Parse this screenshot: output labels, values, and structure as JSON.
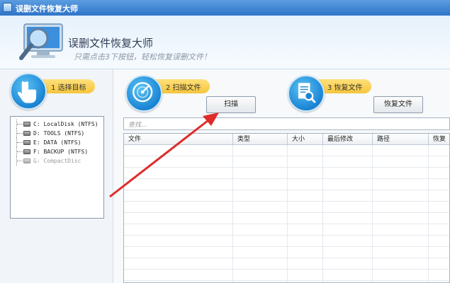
{
  "window": {
    "title": "误删文件恢复大师"
  },
  "header": {
    "app_name": "误删文件恢复大师",
    "tagline": "只需点击3下按钮，轻松恢复误删文件！"
  },
  "steps": [
    {
      "label": "1 选择目标",
      "icon": "hand-pointer-icon"
    },
    {
      "label": "2 扫描文件",
      "icon": "scan-radar-icon"
    },
    {
      "label": "3 恢复文件",
      "icon": "document-search-icon"
    }
  ],
  "drives": [
    {
      "label": "C: LocalDisk (NTFS)",
      "enabled": true
    },
    {
      "label": "D: TOOLS (NTFS)",
      "enabled": true
    },
    {
      "label": "E: DATA (NTFS)",
      "enabled": true
    },
    {
      "label": "F: BACKUP (NTFS)",
      "enabled": true
    },
    {
      "label": "G: CompactDisc",
      "enabled": false
    }
  ],
  "buttons": {
    "scan": "扫描",
    "recover": "恢复文件"
  },
  "search": {
    "placeholder": "查找..."
  },
  "table": {
    "columns": [
      "文件",
      "类型",
      "大小",
      "最后修改",
      "路径",
      "恢复"
    ],
    "rows": []
  },
  "colors": {
    "titlebar": "#2f74c8",
    "step_circle": "#1a84d4",
    "step_label": "#f6c53b",
    "annotation_arrow": "#e02b2b"
  }
}
